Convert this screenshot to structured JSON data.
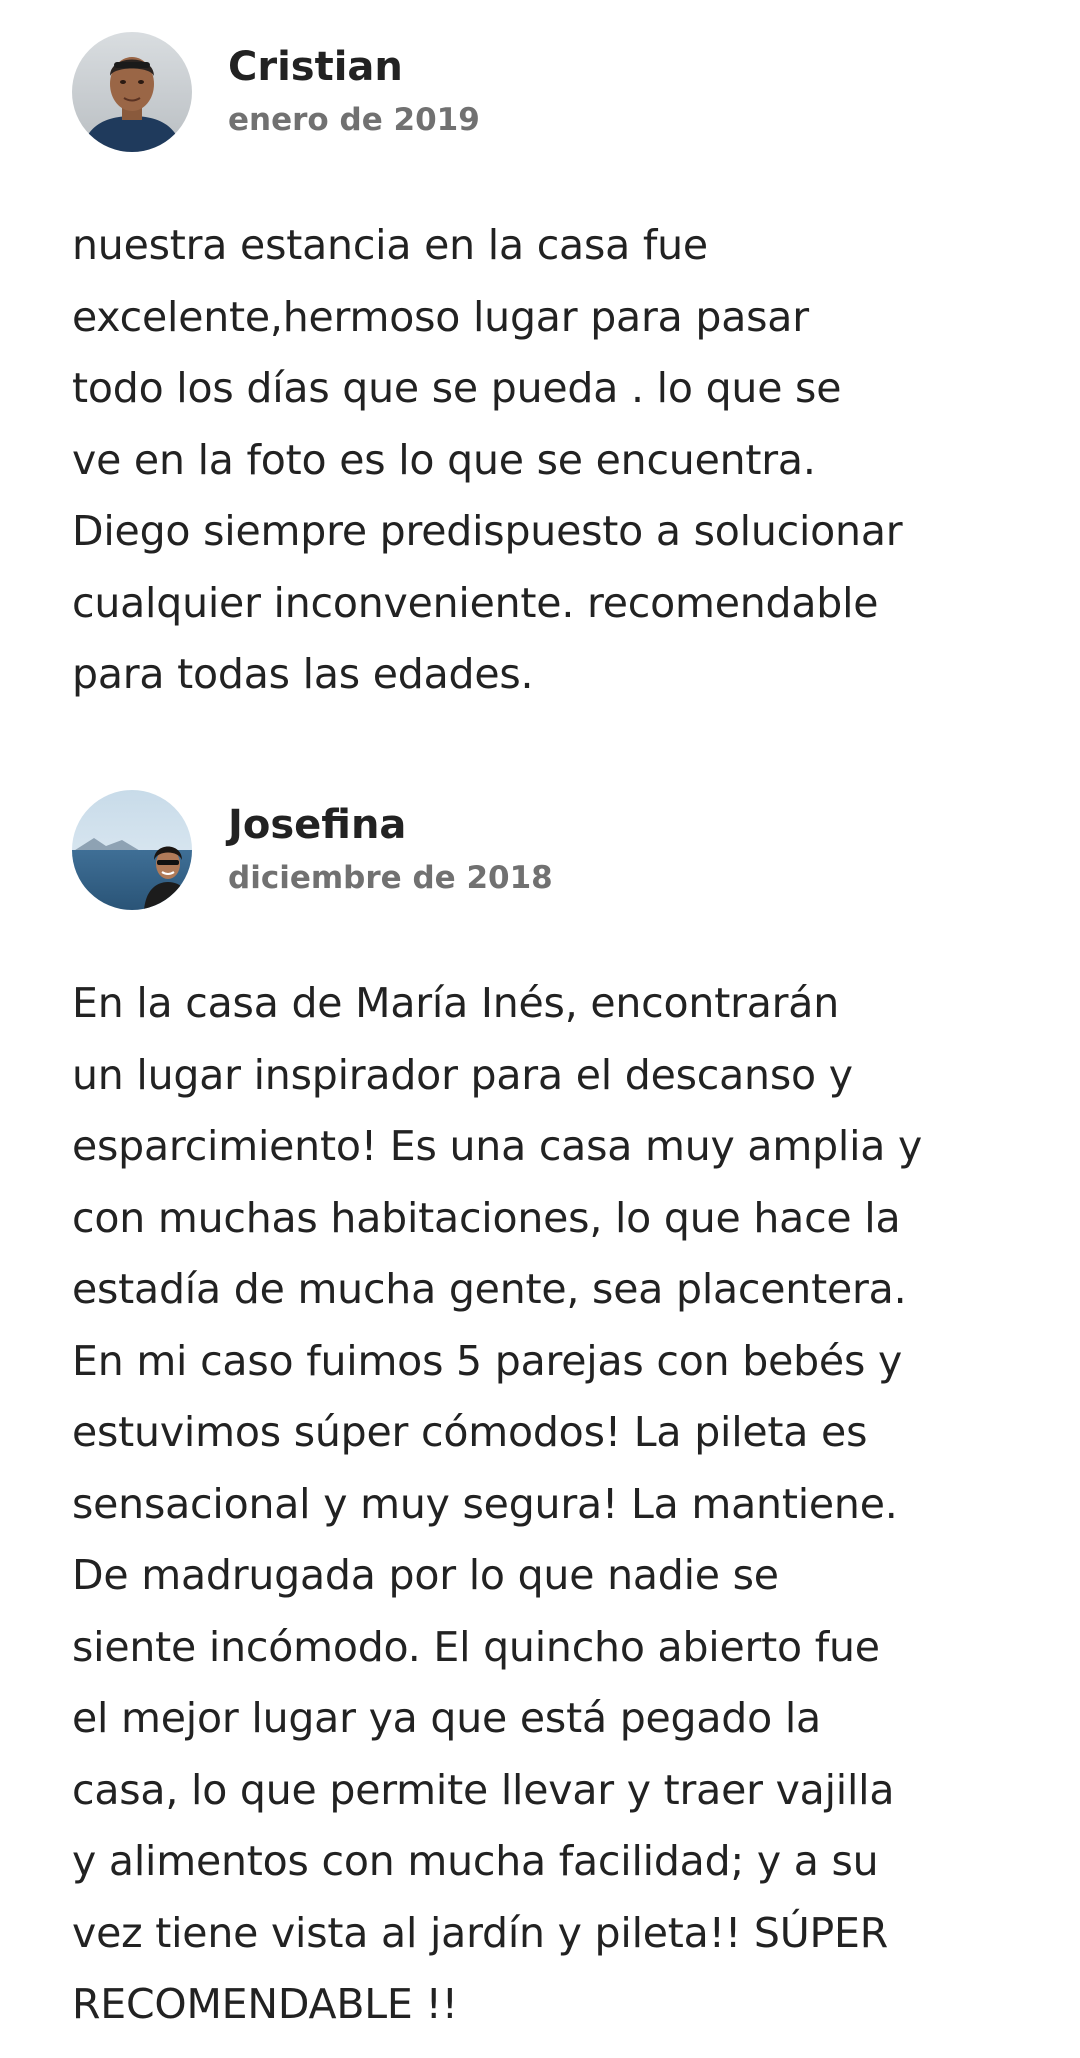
{
  "reviews": [
    {
      "name": "Cristian",
      "date": "enero de 2019",
      "avatar_icon": "user-avatar-photo",
      "text": "nuestra estancia en la casa fue\nexcelente,hermoso lugar para pasar\ntodo los días que se pueda . lo que se\nve en la foto es lo que se encuentra.\nDiego siempre predispuesto a solucionar\ncualquier inconveniente. recomendable\npara todas las edades."
    },
    {
      "name": "Josefina",
      "date": "diciembre de 2018",
      "avatar_icon": "user-avatar-photo",
      "text": "En la casa de María Inés, encontrarán\nun lugar inspirador para el descanso y\nesparcimiento! Es una casa muy amplia y\ncon muchas habitaciones, lo que hace la\nestadía de mucha gente, sea placentera.\nEn mi caso fuimos 5 parejas con bebés y\nestuvimos súper cómodos! La pileta es\nsensacional y muy segura! La mantiene.\nDe madrugada por lo que nadie se\nsiente incómodo. El quincho abierto fue\nel mejor lugar ya que está pegado la\ncasa, lo que permite llevar y traer vajilla\ny alimentos con mucha facilidad; y a su\nvez tiene vista al jardín y pileta!! SÚPER\nRECOMENDABLE !!"
    }
  ],
  "colors": {
    "text_primary": "#222222",
    "text_secondary": "#717171",
    "background": "#ffffff"
  }
}
